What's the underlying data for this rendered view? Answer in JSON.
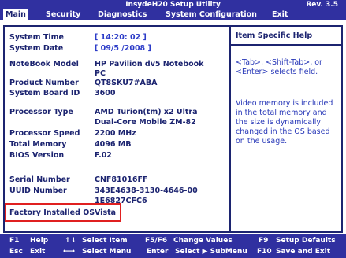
{
  "title_bar": {
    "utility": "InsydeH20 Setup Utility",
    "revision": "Rev. 3.5"
  },
  "menu": {
    "tabs": [
      {
        "label": "Main",
        "active": true
      },
      {
        "label": "Security",
        "active": false
      },
      {
        "label": "Diagnostics",
        "active": false
      },
      {
        "label": "System Configuration",
        "active": false
      },
      {
        "label": "Exit",
        "active": false
      }
    ]
  },
  "main": {
    "system_time": {
      "label": "System Time",
      "value": "[ 14:20: 02 ]"
    },
    "system_date": {
      "label": "System Date",
      "value": "[ 09/5 /2008 ]"
    },
    "notebook_model": {
      "label": "NoteBook Model",
      "value_line1": "HP Pavilion dv5 Notebook",
      "value_line2": "PC"
    },
    "product_number": {
      "label": "Product Number",
      "value": "QT8SKU7#ABA"
    },
    "system_board_id": {
      "label": "System Board ID",
      "value": "3600"
    },
    "processor_type": {
      "label": "Processor Type",
      "value_line1": "AMD Turion(tm) x2 Ultra",
      "value_line2": "Dual-Core Mobile ZM-82"
    },
    "processor_speed": {
      "label": "Processor Speed",
      "value": "2200 MHz"
    },
    "total_memory": {
      "label": "Total Memory",
      "value": "4096 MB"
    },
    "bios_version": {
      "label": "BIOS Version",
      "value": "F.02"
    },
    "serial_number": {
      "label": "Serial Number",
      "value": "CNF81016FF"
    },
    "uuid_number": {
      "label": "UUID Number",
      "value_line1": "343E4638-3130-4646-00",
      "value_line2": "1E6827CFC6"
    },
    "factory_os": {
      "label": "Factory Installed OS",
      "value": "Vista"
    }
  },
  "help": {
    "title": "Item Specific Help",
    "line1": "<Tab>, <Shift-Tab>, or",
    "line2": "<Enter> selects field.",
    "note_line1": "Video memory is included",
    "note_line2": "in the total memory and",
    "note_line3": "the size is dynamically",
    "note_line4": "changed in the OS based",
    "note_line5": "on the usage."
  },
  "keys": {
    "f1": {
      "key": "F1",
      "desc": "Help"
    },
    "updown": {
      "key": "↑↓",
      "desc": "Select Item"
    },
    "f5f6": {
      "key": "F5/F6",
      "desc": "Change Values"
    },
    "f9": {
      "key": "F9",
      "desc": "Setup Defaults"
    },
    "esc": {
      "key": "Esc",
      "desc": "Exit"
    },
    "leftright": {
      "key": "←→",
      "desc": "Select Menu"
    },
    "enter": {
      "key": "Enter",
      "desc": "Select ▶ SubMenu"
    },
    "f10": {
      "key": "F10",
      "desc": "Save and Exit"
    }
  },
  "colors": {
    "bar_blue": "#3030a0",
    "text_navy": "#1c2470",
    "highlight_red": "#e02020"
  }
}
